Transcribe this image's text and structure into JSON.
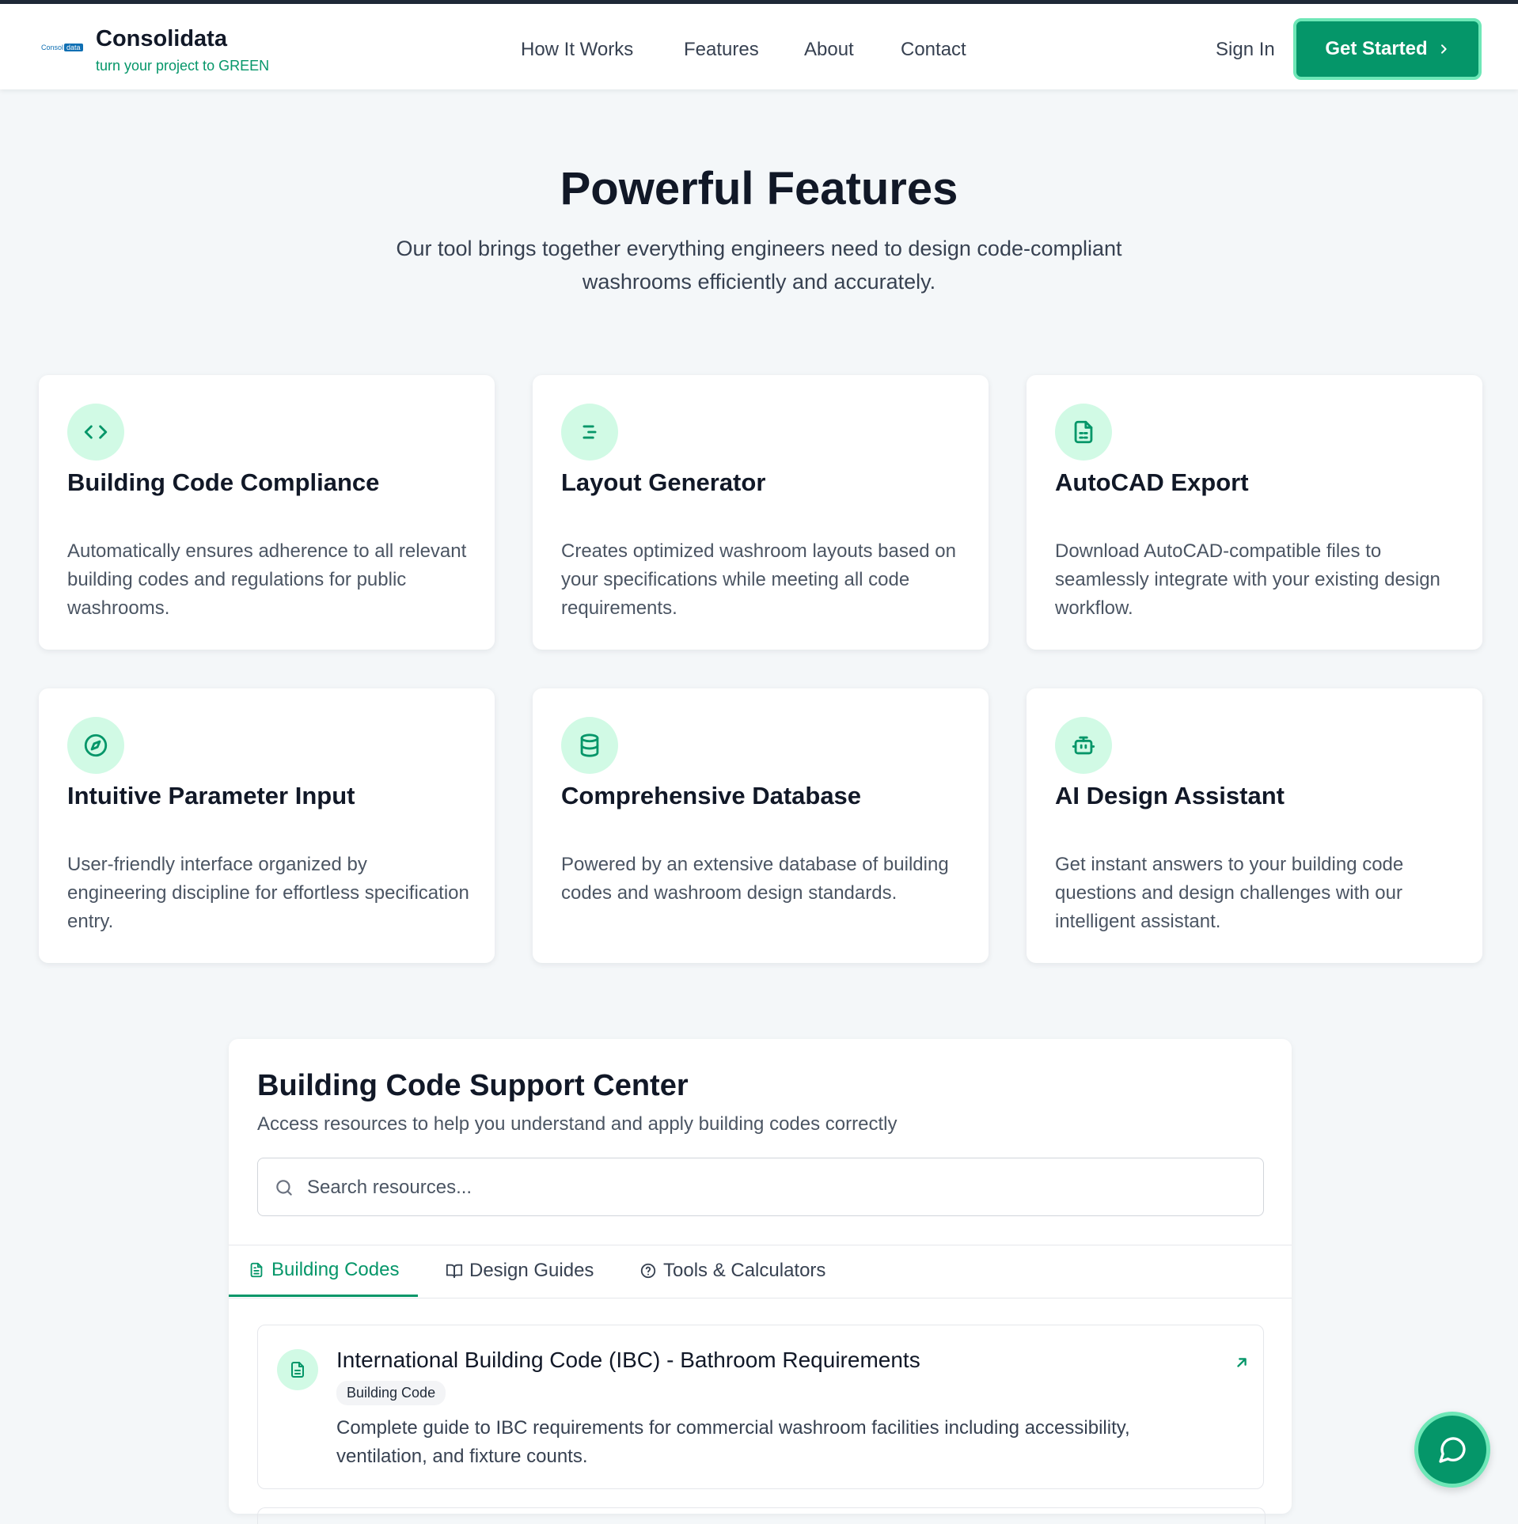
{
  "header": {
    "logo_text": "Consol",
    "logo_highlight": "data",
    "brand_name": "Consolidata",
    "tagline": "turn your project to GREEN",
    "nav": [
      {
        "label": "How It Works"
      },
      {
        "label": "Features"
      },
      {
        "label": "About"
      },
      {
        "label": "Contact"
      }
    ],
    "sign_in": "Sign In",
    "get_started": "Get Started"
  },
  "features": {
    "title": "Powerful Features",
    "subtitle": "Our tool brings together everything engineers need to design code-compliant washrooms efficiently and accurately.",
    "cards": [
      {
        "icon": "code-icon",
        "title": "Building Code Compliance",
        "text": "Automatically ensures adherence to all relevant building codes and regulations for public washrooms."
      },
      {
        "icon": "align-icon",
        "title": "Layout Generator",
        "text": "Creates optimized washroom layouts based on your specifications while meeting all code requirements."
      },
      {
        "icon": "file-spreadsheet-icon",
        "title": "AutoCAD Export",
        "text": "Download AutoCAD-compatible files to seamlessly integrate with your existing design workflow."
      },
      {
        "icon": "compass-icon",
        "title": "Intuitive Parameter Input",
        "text": "User-friendly interface organized by engineering discipline for effortless specification entry."
      },
      {
        "icon": "database-icon",
        "title": "Comprehensive Database",
        "text": "Powered by an extensive database of building codes and washroom design standards."
      },
      {
        "icon": "bot-icon",
        "title": "AI Design Assistant",
        "text": "Get instant answers to your building code questions and design challenges with our intelligent assistant."
      }
    ]
  },
  "support": {
    "title": "Building Code Support Center",
    "subtitle": "Access resources to help you understand and apply building codes correctly",
    "search_placeholder": "Search resources...",
    "search_value": "",
    "tabs": [
      {
        "label": "Building Codes",
        "icon": "file-text-icon",
        "active": true
      },
      {
        "label": "Design Guides",
        "icon": "book-open-icon",
        "active": false
      },
      {
        "label": "Tools & Calculators",
        "icon": "help-circle-icon",
        "active": false
      }
    ],
    "resources": [
      {
        "title": "International Building Code (IBC) - Bathroom Requirements",
        "badge": "Building Code",
        "description": "Complete guide to IBC requirements for commercial washroom facilities including accessibility, ventilation, and fixture counts.",
        "icon": "file-text-icon",
        "link_icon": "external-link-icon"
      }
    ]
  },
  "chat": {
    "icon": "message-circle-icon"
  },
  "colors": {
    "accent": "#059669",
    "accent_light": "#d1fae5",
    "accent_border": "#6ee7b7",
    "background": "#f4f7f9"
  }
}
